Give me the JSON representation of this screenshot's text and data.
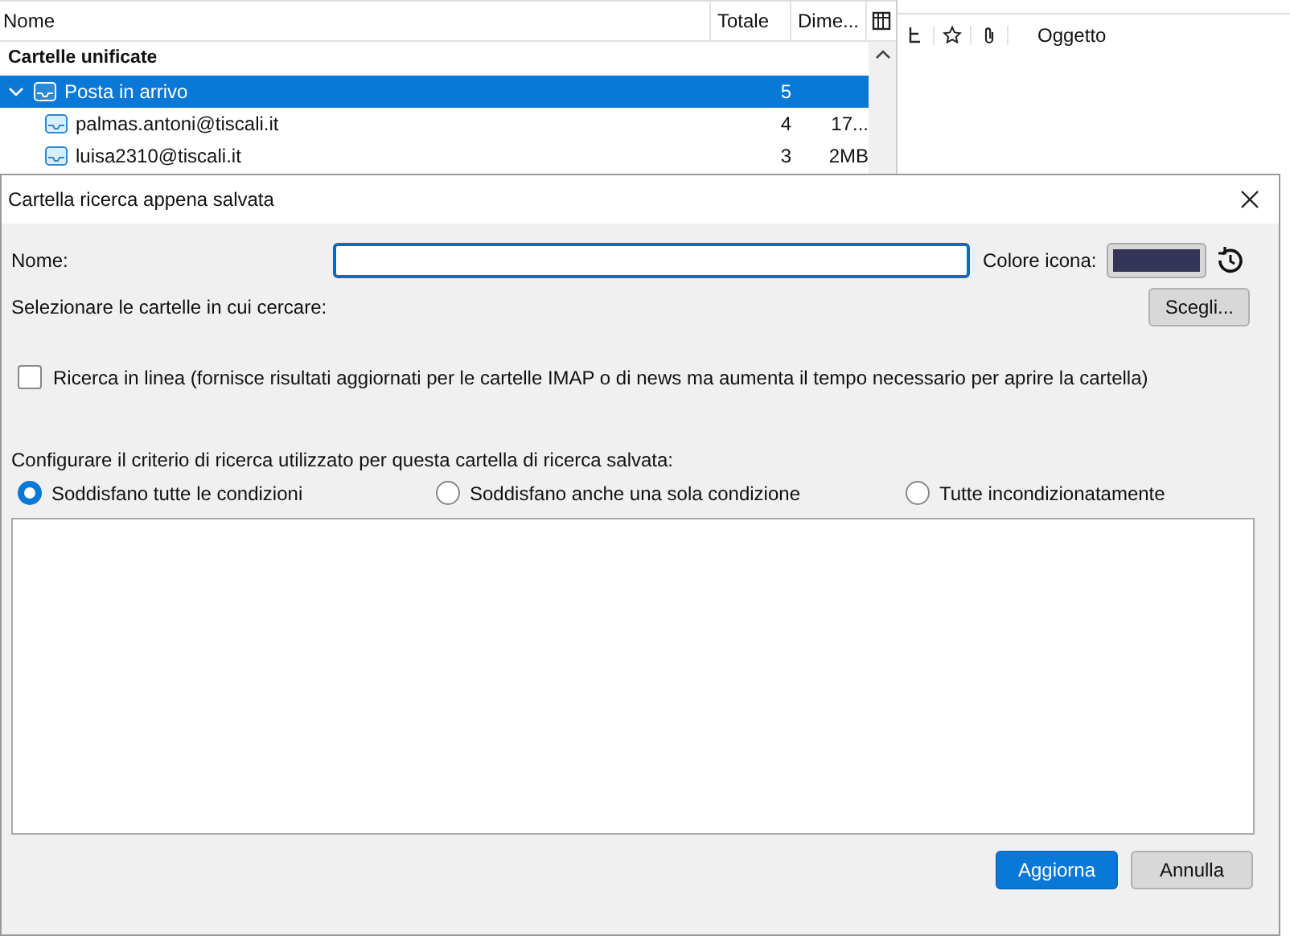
{
  "folder_pane": {
    "columns": [
      "Nome",
      "Totale",
      "Dime..."
    ],
    "section": "Cartelle unificate",
    "folders": [
      {
        "name": "Posta in arrivo",
        "total": "5",
        "selected": true,
        "expanded": true,
        "children": [
          {
            "name": "palmas.antoni@tiscali.it",
            "total": "4",
            "size": "17...",
            "selected": false
          },
          {
            "name": "luisa2310@tiscali.it",
            "total": "3",
            "size": "2MB",
            "selected": false
          }
        ]
      }
    ]
  },
  "message_list": {
    "columns": [
      "Oggetto"
    ]
  },
  "dialog": {
    "title": "Cartella ricerca appena salvata",
    "name_label": "Nome:",
    "color_label": "Colore icona:",
    "folders_label": "Selezionare le cartelle in cui cercare:",
    "choose_button": "Scegli...",
    "online_search": {
      "label": "Ricerca in linea (fornisce risultati aggiornati per le cartelle IMAP o di news ma aumenta il tempo necessario per aprire la cartella)",
      "checked": false
    },
    "criteria_label": "Configurare il criterio di ricerca utilizzato per questa cartella di ricerca salvata:",
    "match_options": [
      {
        "label": "Soddisfano tutte le condizioni",
        "selected": true
      },
      {
        "label": "Soddisfano anche una sola condizione",
        "selected": false
      },
      {
        "label": "Tutte incondizionatamente",
        "selected": false
      }
    ],
    "buttons": [
      {
        "label": "Aggiorna",
        "kind": "primary"
      },
      {
        "label": "Annulla",
        "kind": "secondary"
      }
    ]
  }
}
